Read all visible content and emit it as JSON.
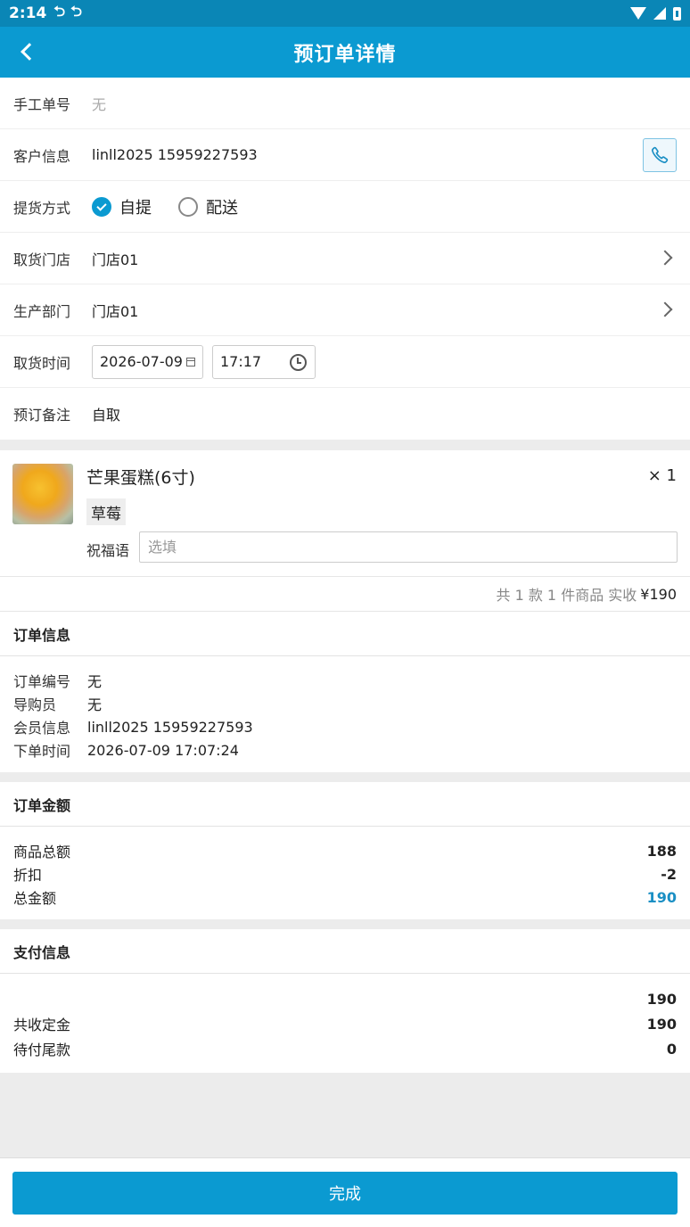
{
  "statusbar": {
    "time": "2:14",
    "icon1": "⮌",
    "icon2": "⮌"
  },
  "header": {
    "title": "预订单详情"
  },
  "form": {
    "manual_no": {
      "label": "手工单号",
      "value": "无"
    },
    "customer": {
      "label": "客户信息",
      "value": "linll2025 15959227593"
    },
    "delivery": {
      "label": "提货方式",
      "options": [
        "自提",
        "配送"
      ],
      "selected": "自提"
    },
    "pickup_store": {
      "label": "取货门店",
      "value": "门店01"
    },
    "production_dept": {
      "label": "生产部门",
      "value": "门店01"
    },
    "pickup_time": {
      "label": "取货时间",
      "date": "2026-07-09",
      "time": "17:17"
    },
    "remark": {
      "label": "预订备注",
      "value": "自取"
    }
  },
  "product": {
    "name": "芒果蛋糕(6寸)",
    "qty": "× 1",
    "tag": "草莓",
    "blessing_label": "祝福语",
    "blessing_placeholder": "选填"
  },
  "summary": {
    "text": "共 1 款 1 件商品 实收",
    "amount": "¥190"
  },
  "order_info": {
    "title": "订单信息",
    "rows": [
      {
        "label": "订单编号",
        "value": "无"
      },
      {
        "label": "导购员",
        "value": "无"
      },
      {
        "label": "会员信息",
        "value": "linll2025 15959227593"
      },
      {
        "label": "下单时间",
        "value": "2026-07-09 17:07:24"
      }
    ]
  },
  "order_amount": {
    "title": "订单金额",
    "rows": [
      {
        "label": "商品总额",
        "value": "188"
      },
      {
        "label": "折扣",
        "value": "-2"
      },
      {
        "label": "总金额",
        "value": "190"
      }
    ]
  },
  "payment": {
    "title": "支付信息",
    "rows": [
      {
        "label": "",
        "value": "190"
      },
      {
        "label": "共收定金",
        "value": "190"
      },
      {
        "label": "待付尾款",
        "value": "0"
      }
    ]
  },
  "footer": {
    "done_label": "完成"
  },
  "colors": {
    "header": "#0b9ad1",
    "statusbar": "#0a86b6",
    "accent_blue": "#1a8fc4"
  }
}
